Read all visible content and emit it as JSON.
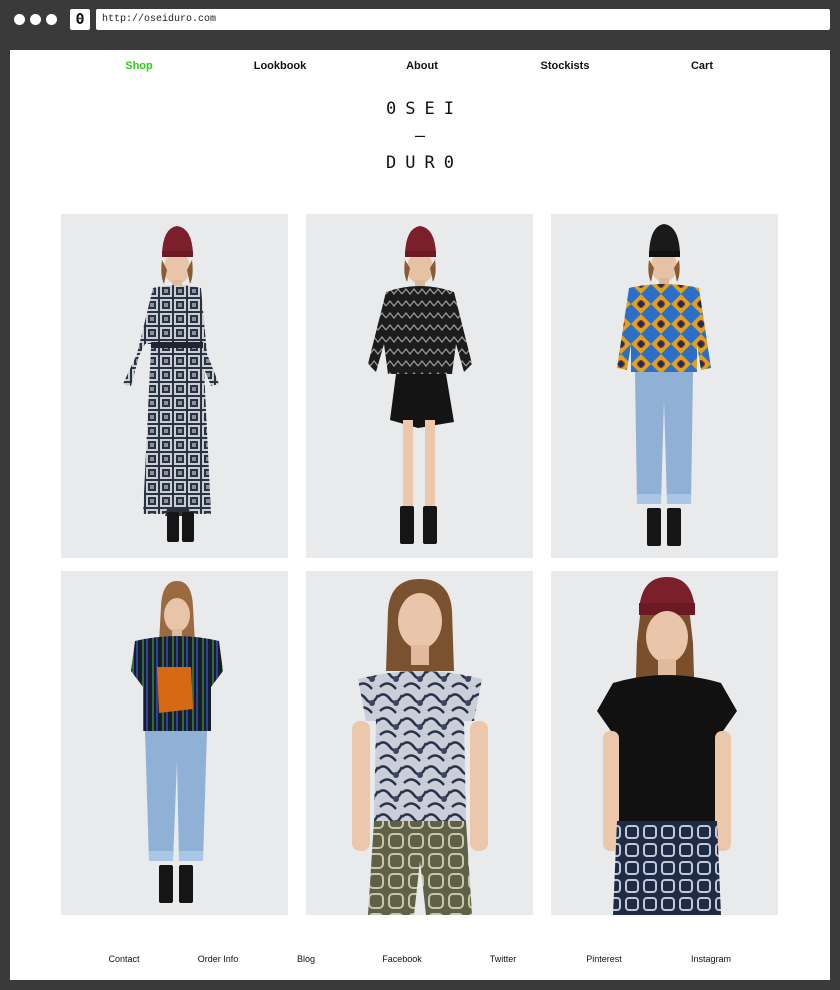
{
  "browser": {
    "url": "http://oseiduro.com",
    "favicon_glyph": "0"
  },
  "nav": {
    "items": [
      {
        "label": "Shop",
        "active": true
      },
      {
        "label": "Lookbook"
      },
      {
        "label": "About"
      },
      {
        "label": "Stockists"
      },
      {
        "label": "Cart"
      }
    ]
  },
  "logo": {
    "line1": "0SEI",
    "line2": "–",
    "line3": "DUR0"
  },
  "products": [
    {
      "name": "product-1",
      "beanie": "maroon",
      "top": "indigo-batik-longsleeve",
      "bottom": "indigo-batik-maxi-skirt",
      "legs": "hidden"
    },
    {
      "name": "product-2",
      "beanie": "maroon",
      "top": "black-zigzag-top",
      "bottom": "black-shorts",
      "legs": "bare"
    },
    {
      "name": "product-3",
      "beanie": "black",
      "top": "wax-print-top",
      "bottom": "light-jeans",
      "legs": "jeans"
    },
    {
      "name": "product-4",
      "beanie": "none",
      "top": "fringe-knit-top",
      "bottom": "light-jeans",
      "legs": "jeans"
    },
    {
      "name": "product-5",
      "beanie": "none",
      "top": "batik-grey-top",
      "bottom": "olive-print-pants",
      "legs": "cropped"
    },
    {
      "name": "product-6",
      "beanie": "maroon",
      "top": "black-sleeveless-top",
      "bottom": "indigo-batik-skirt",
      "legs": "cropped"
    }
  ],
  "footer": {
    "links": [
      "Contact",
      "Order Info",
      "Blog",
      "Facebook",
      "Twitter",
      "Pinterest",
      "Instagram"
    ]
  },
  "colors": {
    "accent_active": "#2ecc1a",
    "chrome": "#3a3a3a",
    "card_bg": "#e9eaeb"
  }
}
